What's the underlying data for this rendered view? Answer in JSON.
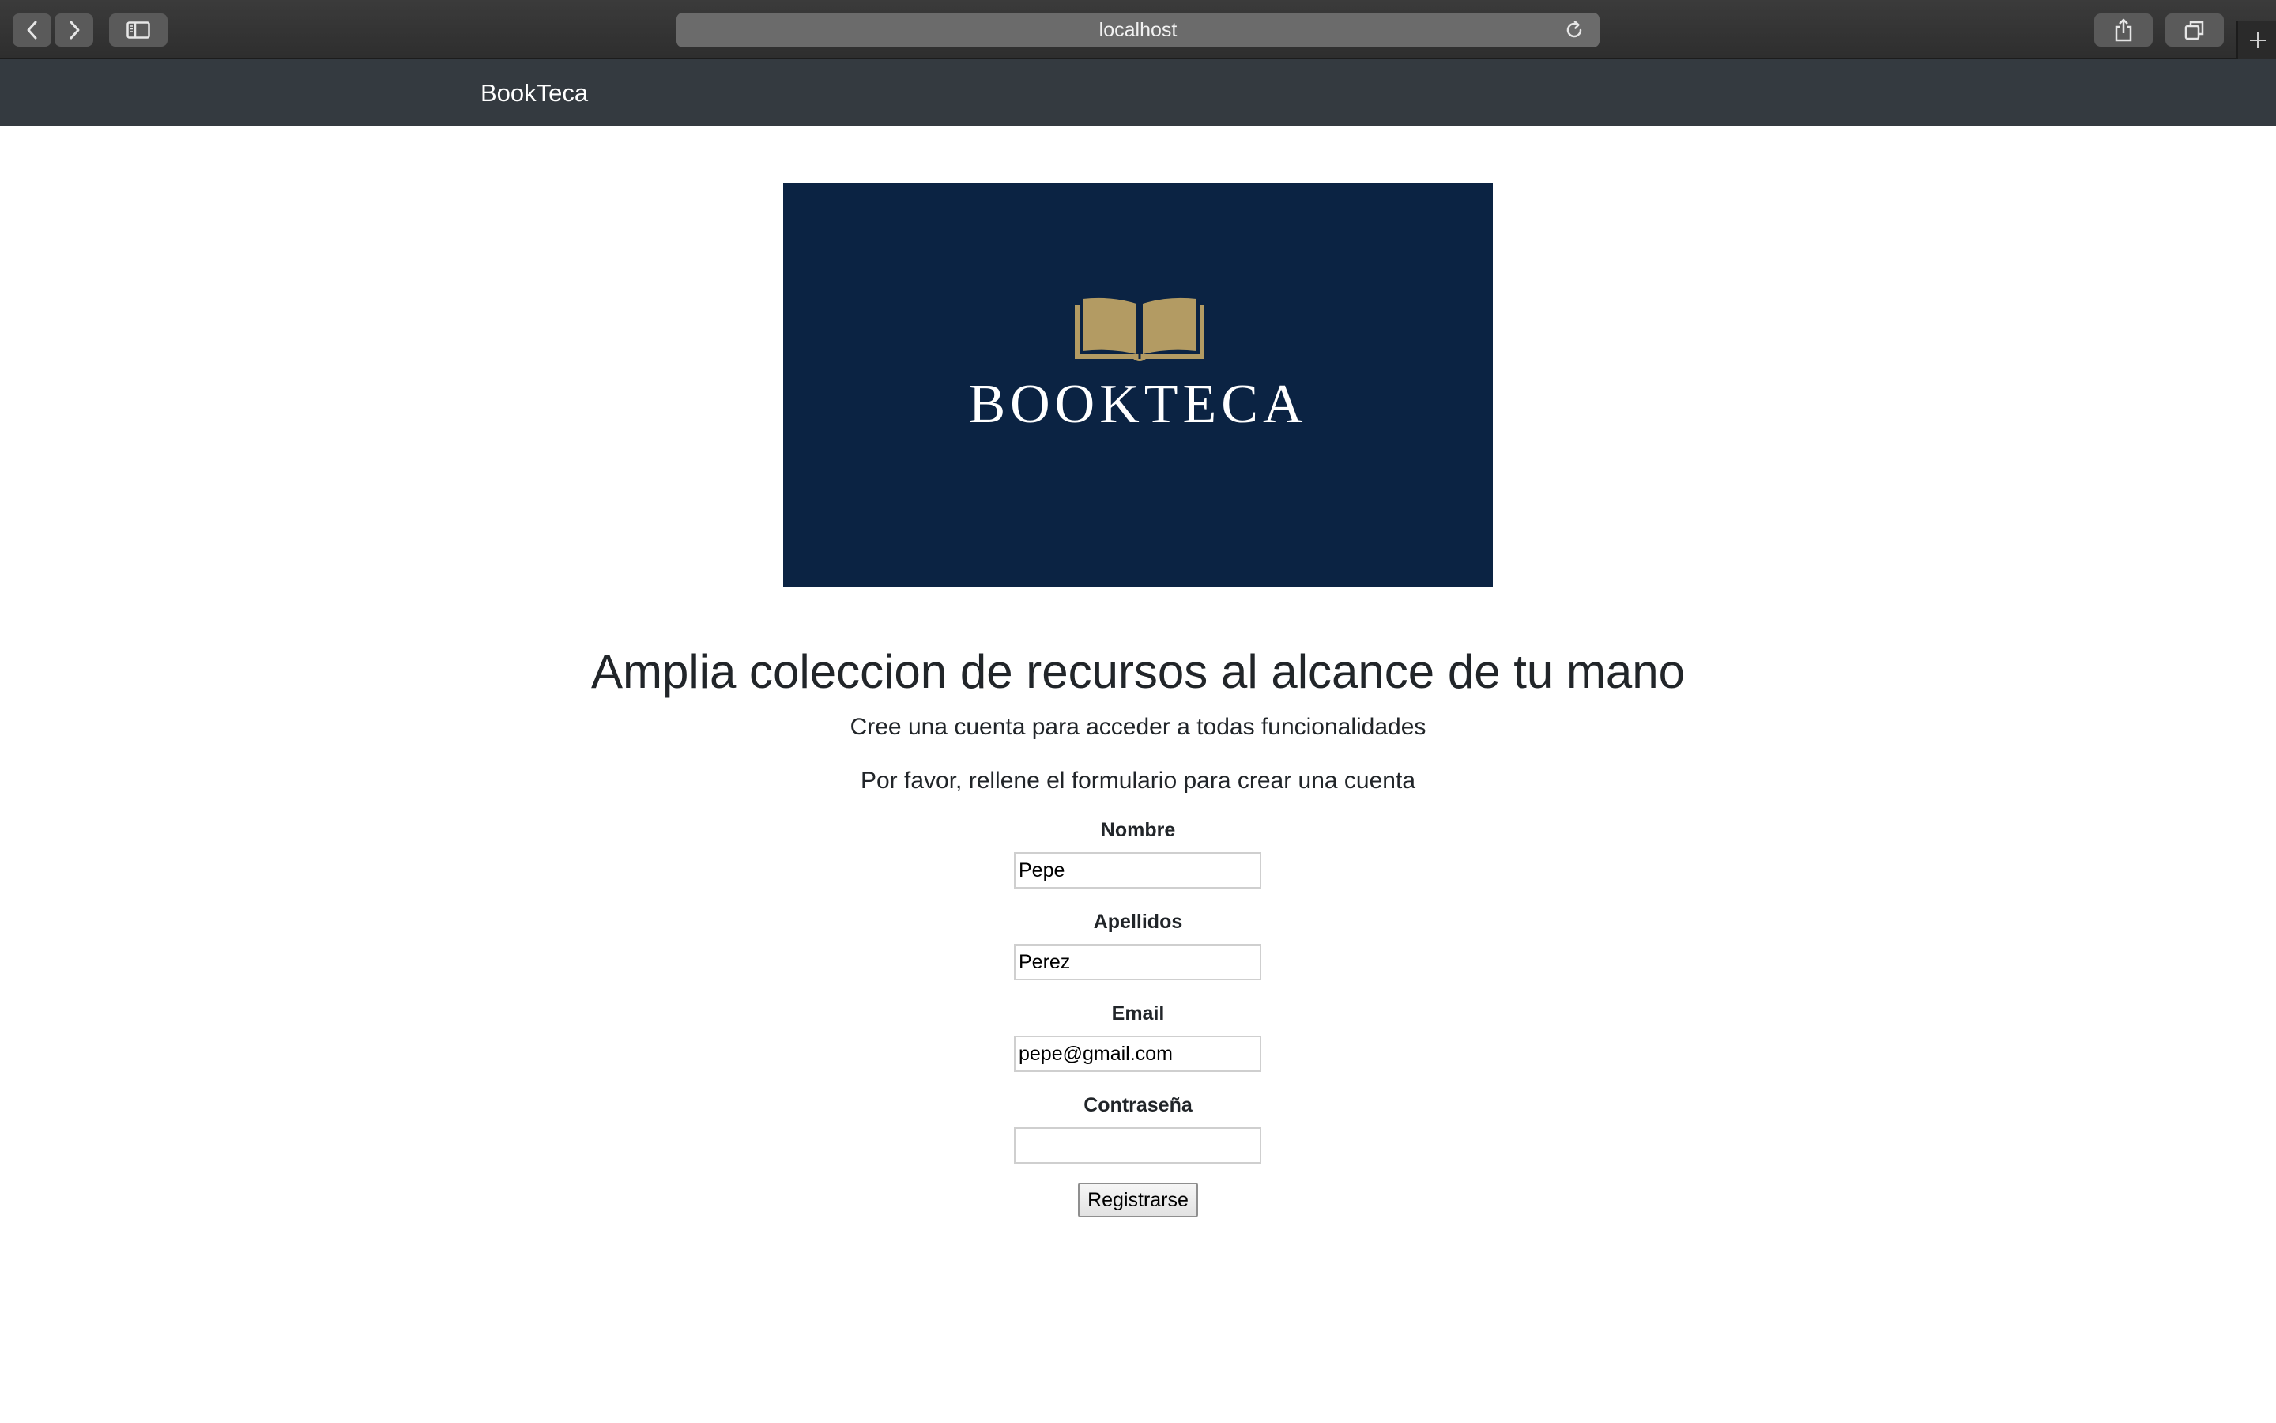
{
  "browser": {
    "url": "localhost",
    "icons": {
      "back": "chevron-left-icon",
      "forward": "chevron-right-icon",
      "sidebar": "sidebar-icon",
      "reload": "reload-icon",
      "share": "share-icon",
      "tabs": "tabs-icon",
      "new_tab": "plus-icon"
    }
  },
  "navbar": {
    "brand": "BookTeca"
  },
  "logo": {
    "text": "BOOKTECA",
    "colors": {
      "background": "#0b2343",
      "book": "#b39b63",
      "text": "#ffffff"
    }
  },
  "hero": {
    "title": "Amplia coleccion de recursos al alcance de tu mano",
    "subtitle": "Cree una cuenta para acceder a todas funcionalidades",
    "instructions": "Por favor, rellene el formulario para crear una cuenta"
  },
  "form": {
    "fields": [
      {
        "label": "Nombre",
        "value": "Pepe"
      },
      {
        "label": "Apellidos",
        "value": "Perez"
      },
      {
        "label": "Email",
        "value": "pepe@gmail.com"
      },
      {
        "label": "Contraseña",
        "value": ""
      }
    ],
    "submit_label": "Registrarse"
  }
}
